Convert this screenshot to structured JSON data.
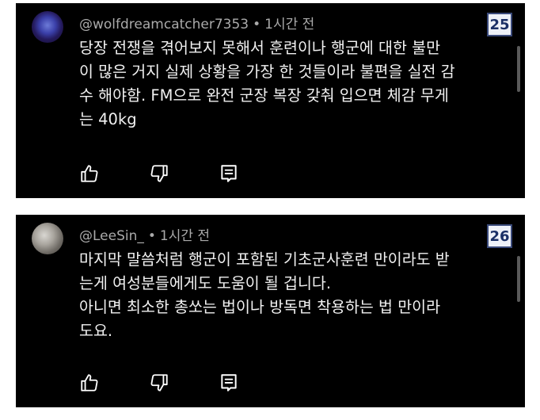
{
  "comments": [
    {
      "username": "@wolfdreamcatcher7353",
      "separator": "•",
      "time": "1시간 전",
      "badge": "25",
      "lines": [
        "당장 전쟁을 겪어보지 못해서 훈련이나 행군에 대한 불만",
        "이 많은 거지 실제 상황을 가장 한 것들이라 불편을 실전 감",
        "수 해야함. FM으로 완전 군장 복장 갖춰 입으면 체감 무게",
        "는 40kg"
      ]
    },
    {
      "username": "@LeeSin_",
      "separator": "•",
      "time": "1시간 전",
      "badge": "26",
      "lines": [
        "마지막 말씀처럼 행군이 포함된 기초군사훈련 만이라도 받",
        "는게 여성분들에게도 도움이 될 겁니다.",
        "아니면 최소한 총쏘는 법이나 방독면 착용하는 법 만이라",
        "도요."
      ]
    }
  ],
  "icons": {
    "like": "thumbs-up-icon",
    "dislike": "thumbs-down-icon",
    "reply": "reply-comment-icon"
  }
}
